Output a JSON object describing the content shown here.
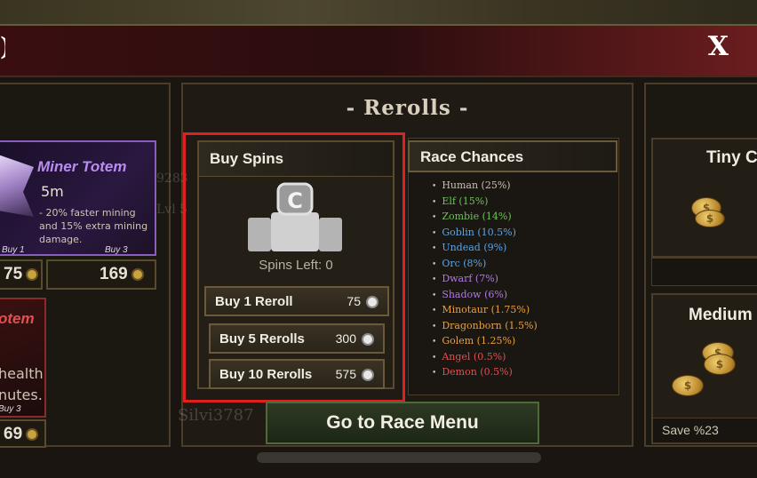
{
  "window": {
    "close_label": "X",
    "back_glyph": ")"
  },
  "ghost_text": {
    "num": "9283",
    "lvl": "Lvl 5",
    "player": "Silvi3787"
  },
  "left_panel": {
    "miner_totem": {
      "title": "Miner Totem",
      "duration": "5m",
      "description": "- 20% faster mining and 15% extra mining damage.",
      "buy1_label": "Buy 1",
      "buy3_label": "Buy 3",
      "price1": "75",
      "price3": "169"
    },
    "totem2": {
      "title": "otem",
      "line1": "health",
      "line2": "nutes.",
      "buy3_label": "Buy 3",
      "price": "69"
    }
  },
  "center_panel": {
    "title": "- Rerolls -",
    "buy_spins": {
      "title": "Buy Spins",
      "spins_left": "Spins Left: 0",
      "options": [
        {
          "label": "Buy 1 Reroll",
          "price": "75"
        },
        {
          "label": "Buy 5 Rerolls",
          "price": "300"
        },
        {
          "label": "Buy 10 Rerolls",
          "price": "575"
        }
      ]
    },
    "race_chances": {
      "title": "Race Chances",
      "races": [
        {
          "label": "Human (25%)",
          "color": "#c8c0b0"
        },
        {
          "label": "Elf (15%)",
          "color": "#6fc25a"
        },
        {
          "label": "Zombie (14%)",
          "color": "#6fc25a"
        },
        {
          "label": "Goblin (10.5%)",
          "color": "#5aa6e8"
        },
        {
          "label": "Undead (9%)",
          "color": "#5aa6e8"
        },
        {
          "label": "Orc (8%)",
          "color": "#5aa6e8"
        },
        {
          "label": "Dwarf (7%)",
          "color": "#b07ae8"
        },
        {
          "label": "Shadow (6%)",
          "color": "#b07ae8"
        },
        {
          "label": "Minotaur (1.75%)",
          "color": "#e8a040"
        },
        {
          "label": "Dragonborn (1.5%)",
          "color": "#e8a040"
        },
        {
          "label": "Golem (1.25%)",
          "color": "#e8a040"
        },
        {
          "label": "Angel (0.5%)",
          "color": "#e05050"
        },
        {
          "label": "Demon (0.5%)",
          "color": "#e05050"
        }
      ]
    },
    "go_button": "Go to Race Menu"
  },
  "right_panel": {
    "tiny": {
      "title": "Tiny C"
    },
    "medium": {
      "title": "Medium",
      "save": "Save %23"
    }
  }
}
